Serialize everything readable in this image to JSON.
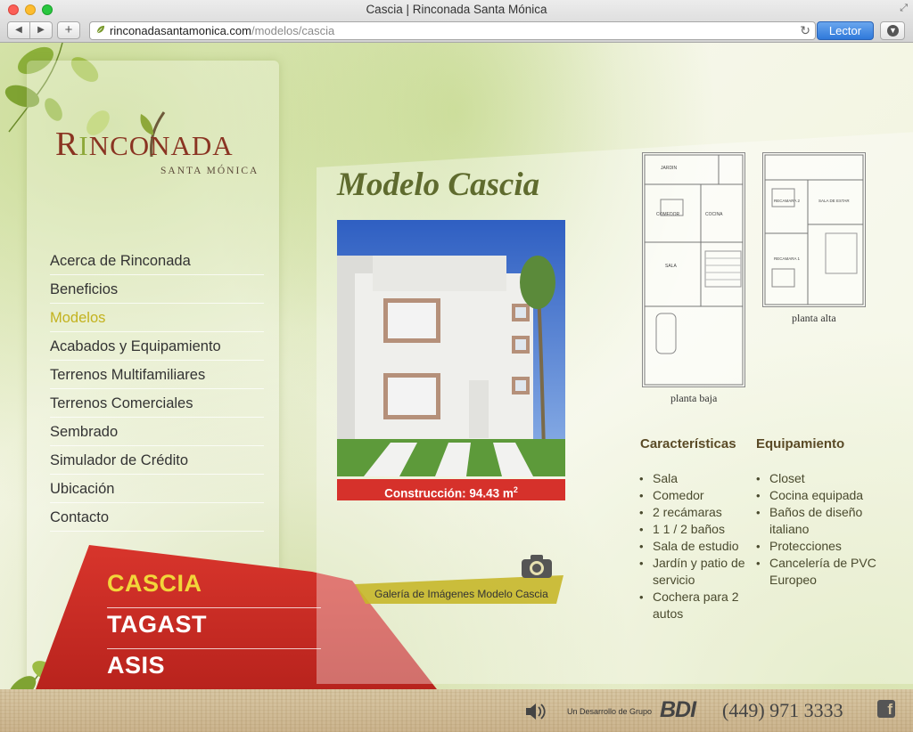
{
  "window": {
    "title": "Cascia | Rinconada Santa Mónica"
  },
  "toolbar": {
    "url_domain": "rinconadasantamonica.com",
    "url_path": "/modelos/cascia",
    "reader_label": "Lector",
    "back_icon": "chevron-left-icon",
    "forward_icon": "chevron-right-icon",
    "add_icon": "plus-icon"
  },
  "logo": {
    "main_prefix": "R",
    "main_i": "I",
    "main_rest": "NCONADA",
    "sub": "SANTA MÓNICA"
  },
  "menu": [
    {
      "label": "Acerca de Rinconada",
      "active": false
    },
    {
      "label": "Beneficios",
      "active": false
    },
    {
      "label": "Modelos",
      "active": true
    },
    {
      "label": "Acabados y Equipamiento",
      "active": false
    },
    {
      "label": "Terrenos Multifamiliares",
      "active": false
    },
    {
      "label": "Terrenos Comerciales",
      "active": false
    },
    {
      "label": "Sembrado",
      "active": false
    },
    {
      "label": "Simulador de Crédito",
      "active": false
    },
    {
      "label": "Ubicación",
      "active": false
    },
    {
      "label": "Contacto",
      "active": false
    }
  ],
  "models": [
    {
      "label": "CASCIA",
      "active": true
    },
    {
      "label": "TAGAST",
      "active": false
    },
    {
      "label": "ASIS",
      "active": false
    }
  ],
  "content": {
    "title": "Modelo Cascia",
    "construction_label": "Construcción: 94.43 m",
    "construction_sup": "2",
    "gallery_label": "Galería de Imágenes Modelo Cascia",
    "plan_low_label": "planta baja",
    "plan_high_label": "planta alta"
  },
  "features": {
    "title": "Características",
    "items": [
      "Sala",
      "Comedor",
      "2 recámaras",
      "1 1 / 2 baños",
      "Sala de estudio",
      "Jardín y patio de servicio",
      "Cochera para 2 autos"
    ]
  },
  "equipment": {
    "title": "Equipamiento",
    "items": [
      "Closet",
      "Cocina equipada",
      "Baños de diseño italiano",
      "Protecciones",
      "Cancelería de PVC Europeo"
    ]
  },
  "footer": {
    "developer_text": "Un Desarrollo de Grupo",
    "developer_brand": "BDI",
    "phone": "(449) 971 3333"
  },
  "colors": {
    "accent_red": "#d6312b",
    "active_yellow": "#c3b21e",
    "title_green": "#5f6b2e"
  }
}
